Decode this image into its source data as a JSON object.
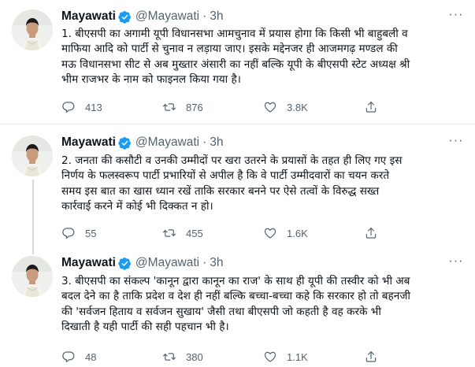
{
  "account": {
    "name": "Mayawati",
    "handle": "@Mayawati",
    "separator": "·",
    "verified_color": "#1d9bf0"
  },
  "tweets": [
    {
      "time": "3h",
      "text": "1. बीएसपी का अगामी यूपी विधानसभा आमचुनाव में प्रयास होगा कि किसी भी बाहुबली व\nमाफिया आदि को पार्टी से चुनाव न लड़ाया जाए। इसके मद्देनजर ही आजमगढ़ मण्डल की\nमऊ विधानसभा सीट से अब मुख्तार अंसारी का नहीं बल्कि यूपी के बीएसपी स्टेट अध्यक्ष श्री\nभीम राजभर के नाम को फाइनल किया गया है।",
      "replies": "413",
      "retweets": "876",
      "likes": "3.8K"
    },
    {
      "time": "3h",
      "text": "2. जनता की कसौटी व उनकी उम्मीदों पर खरा उतरने के प्रयासों के तहत ही लिए गए इस\nनिर्णय के फलस्वरूप पार्टी प्रभारियों से अपील है कि वे पार्टी उम्मीदवारों का चयन करते\nसमय इस बात का खास ध्यान रखें ताकि सरकार बनने पर ऐसे तत्वों के विरुद्ध सख्त\nकार्रवाई करने में कोई भी दिक्कत न हो।",
      "replies": "55",
      "retweets": "455",
      "likes": "1.6K"
    },
    {
      "time": "3h",
      "text": "3. बीएसपी का संकल्प 'कानून द्वारा कानून का राज' के साथ ही यूपी की तस्वीर को भी अब\nबदल देने का है ताकि प्रदेश व देश ही नहीं बल्कि बच्चा-बच्चा कहे कि सरकार हो तो बहनजी\nकी 'सर्वजन हिताय व सर्वजन सुखाय' जैसी तथा बीएसपी जो कहती है वह करके भी\nदिखाती है यही पार्टी की सही पहचान भी है।",
      "replies": "48",
      "retweets": "380",
      "likes": "1.1K"
    }
  ],
  "icons": {
    "reply": "reply-icon",
    "retweet": "retweet-icon",
    "like": "heart-icon",
    "share": "share-icon",
    "more": "more-icon",
    "verified": "verified-badge-icon"
  }
}
